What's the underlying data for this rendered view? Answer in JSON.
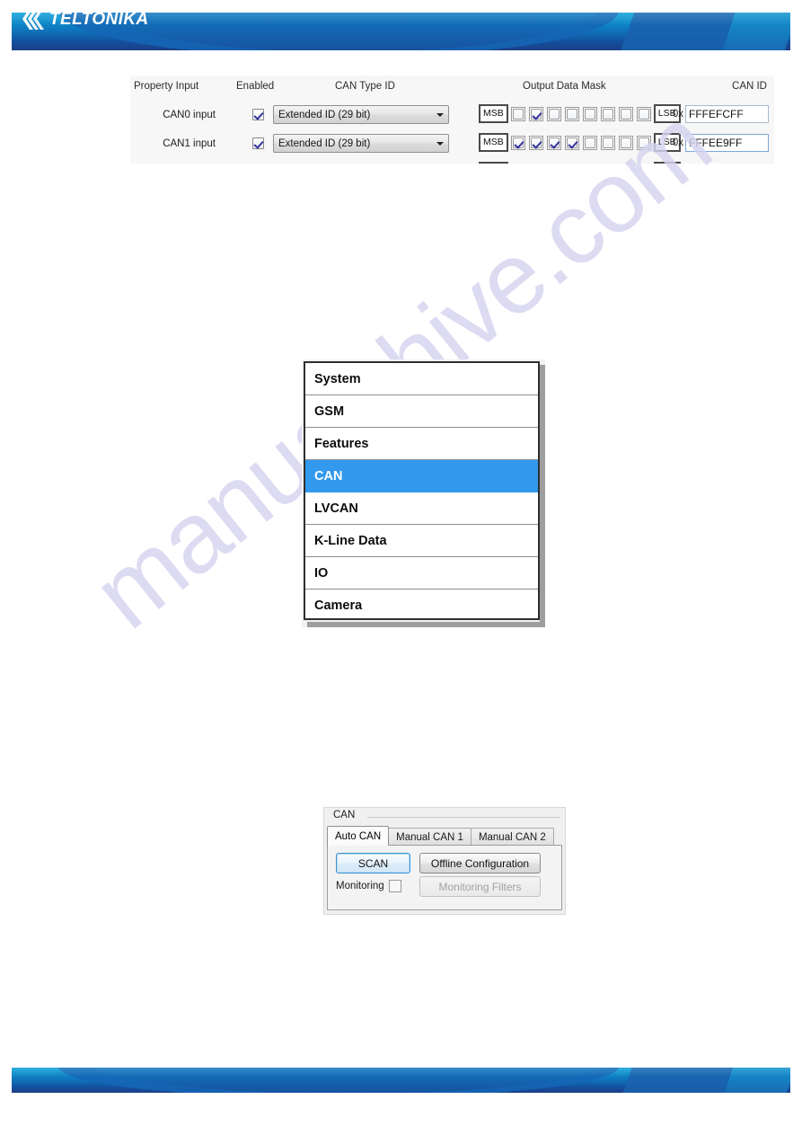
{
  "header": {
    "logo_text": "TELTONIKA",
    "logo_icon": "chevrons-icon"
  },
  "watermark": {
    "text": "manualshive.com"
  },
  "can_properties": {
    "columns": {
      "property_input": "Property Input",
      "enabled": "Enabled",
      "can_type_id": "CAN Type ID",
      "output_data_mask": "Output Data Mask",
      "can_id": "CAN ID"
    },
    "mask_labels": {
      "msb": "MSB",
      "lsb": "LSB"
    },
    "hex_prefix": "0x",
    "rows": [
      {
        "label": "CAN0 input",
        "enabled": true,
        "can_type": "Extended ID (29 bit)",
        "mask": [
          false,
          true,
          false,
          false,
          false,
          false,
          false,
          false
        ],
        "can_id": "FFFEFCFF",
        "focused": false
      },
      {
        "label": "CAN1 input",
        "enabled": true,
        "can_type": "Extended ID (29 bit)",
        "mask": [
          true,
          true,
          true,
          true,
          false,
          false,
          false,
          false
        ],
        "can_id": "FFFEE9FF",
        "focused": true
      }
    ]
  },
  "menu_list": {
    "items": [
      {
        "label": "System",
        "selected": false
      },
      {
        "label": "GSM",
        "selected": false
      },
      {
        "label": "Features",
        "selected": false
      },
      {
        "label": "CAN",
        "selected": true
      },
      {
        "label": "LVCAN",
        "selected": false
      },
      {
        "label": "K-Line Data",
        "selected": false
      },
      {
        "label": "IO",
        "selected": false
      },
      {
        "label": "Camera",
        "selected": false
      }
    ],
    "selected_color": "#3399ee"
  },
  "can_panel": {
    "group_label": "CAN",
    "tabs": [
      {
        "label": "Auto CAN",
        "active": true
      },
      {
        "label": "Manual CAN 1",
        "active": false
      },
      {
        "label": "Manual CAN 2",
        "active": false
      }
    ],
    "scan_button": "SCAN",
    "offline_button": "Offline Configuration",
    "monitoring_label": "Monitoring",
    "monitoring_checked": false,
    "monitoring_filters_button": "Monitoring Filters",
    "monitoring_filters_disabled": true
  }
}
